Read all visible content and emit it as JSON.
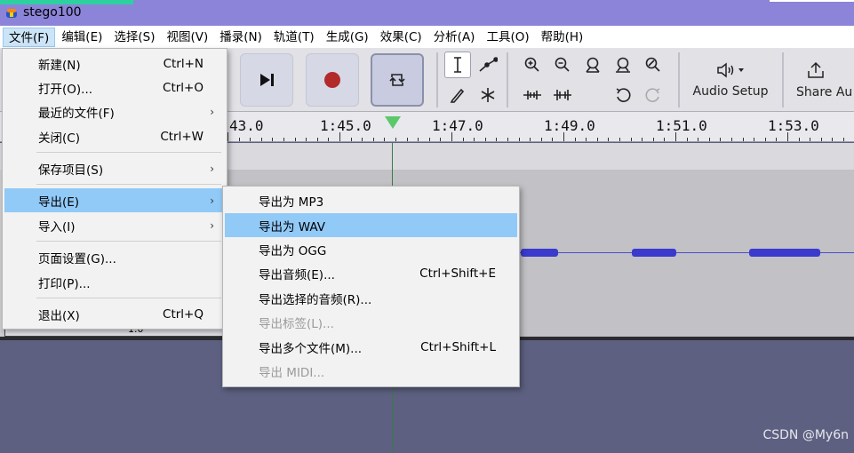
{
  "app": {
    "title": "stego100"
  },
  "menubar": [
    {
      "label": "文件(F)",
      "active": true
    },
    {
      "label": "编辑(E)"
    },
    {
      "label": "选择(S)"
    },
    {
      "label": "视图(V)"
    },
    {
      "label": "播录(N)"
    },
    {
      "label": "轨道(T)"
    },
    {
      "label": "生成(G)"
    },
    {
      "label": "效果(C)"
    },
    {
      "label": "分析(A)"
    },
    {
      "label": "工具(O)"
    },
    {
      "label": "帮助(H)"
    }
  ],
  "toolbar": {
    "audio_setup_label": "Audio Setup",
    "share_label": "Share Au"
  },
  "ruler": {
    "labels": [
      "43.0",
      "1:45.0",
      "1:47.0",
      "1:49.0",
      "1:51.0",
      "1:53.0"
    ]
  },
  "file_menu": {
    "items": [
      {
        "label": "新建(N)",
        "shortcut": "Ctrl+N"
      },
      {
        "label": "打开(O)...",
        "shortcut": "Ctrl+O"
      },
      {
        "label": "最近的文件(F)",
        "submenu": true
      },
      {
        "label": "关闭(C)",
        "shortcut": "Ctrl+W"
      },
      {
        "label": "保存项目(S)",
        "submenu": true
      },
      {
        "label": "导出(E)",
        "submenu": true,
        "highlighted": true
      },
      {
        "label": "导入(I)",
        "submenu": true
      },
      {
        "label": "页面设置(G)..."
      },
      {
        "label": "打印(P)..."
      },
      {
        "label": "退出(X)",
        "shortcut": "Ctrl+Q"
      }
    ]
  },
  "export_menu": {
    "items": [
      {
        "label": "导出为 MP3"
      },
      {
        "label": "导出为 WAV",
        "highlighted": true
      },
      {
        "label": "导出为 OGG"
      },
      {
        "label": "导出音频(E)...",
        "shortcut": "Ctrl+Shift+E"
      },
      {
        "label": "导出选择的音频(R)..."
      },
      {
        "label": "导出标签(L)...",
        "disabled": true
      },
      {
        "label": "导出多个文件(M)...",
        "shortcut": "Ctrl+Shift+L"
      },
      {
        "label": "导出 MIDI...",
        "disabled": true
      }
    ]
  },
  "track": {
    "partial_value": "1.0"
  },
  "watermark": "CSDN @My6n",
  "colors": {
    "titlebar": "#8b84d8",
    "menu_highlight": "#91c9f7",
    "record": "#b22a2a",
    "waveform": "#3a3acc",
    "playhead": "#5cc86a"
  }
}
